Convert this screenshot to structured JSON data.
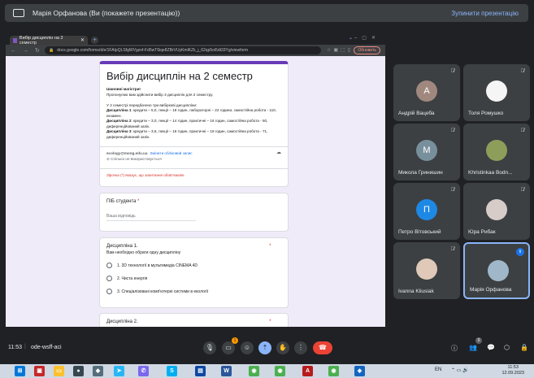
{
  "presentation_bar": {
    "title": "Марія Орфанова (Ви (покажете презентацію))",
    "stop_label": "Зупинити презентацію"
  },
  "browser": {
    "tab_title": "Вибір дисциплін на 2 семестр",
    "url": "docs.google.com/forms/d/e/1FAIpQLSfgWVgznf-Fd5wT6iqe8ZBrVUyKmlKZk_j_62qp5oi5dt33Yg/viewform",
    "update_label": "Обновить"
  },
  "form": {
    "title": "Вибір дисциплін на 2 семестр",
    "greeting": "Шановні магістри!",
    "intro": "Пропонуємо вам здійснити вибір 3 дисциплін для 2 семестру.",
    "offer": "У 2 семестрі передбачено три вибіркові дисципліни:",
    "d1_label": "Дисципліна 1",
    "d1_text": ": кредити – 5,0, лекції – 18 годин, лабораторні – 22 години, самостійна робота - 110, екзамен.",
    "d2_label": "Дисципліна 2",
    "d2_text": ": кредити – 3,0, лекції – 14 годин, практичні – 16 годин, самостійна робота - 60, диференційований залік.",
    "d3_label": "Дисципліна 3",
    "d3_text": ": кредити – 3,5, лекції – 16 годин, практичні – 18 годин, самостійна робота - 71, диференційований залік.",
    "email": "ecology@mong.edu.ua",
    "switch_account": "Змінити обліковий запис",
    "not_shared": "Спільно не використовується",
    "required_note": "Зірочка (*) вказує, що запитання обов'язкове",
    "name_label": "ПІБ студента",
    "star": "*",
    "name_placeholder": "Ваша відповідь",
    "q1_title": "Дисципліна 1.",
    "q1_subtitle": "Вам необхідно обрати одну дисципліну",
    "q1_options": [
      "1. 3D технології в мультимедіа  CINEMA 4D",
      "2. Чиста енергія",
      "3. Спеціалізовані комп'ютерні системи в екології"
    ],
    "q2_title": "Дисципліна 2."
  },
  "participants": [
    {
      "name": "Андрій Вацеба",
      "initial": "А",
      "color": "#a1887f"
    },
    {
      "name": "Толя Ромушко",
      "initial": "",
      "color": "#f5f5f5"
    },
    {
      "name": "Микола Гринишин",
      "initial": "М",
      "color": "#78909c"
    },
    {
      "name": "Khristinkaa Bodn...",
      "initial": "",
      "color": "#8d9e5a"
    },
    {
      "name": "Петро Вітовський",
      "initial": "П",
      "color": "#1e88e5"
    },
    {
      "name": "Юра Рибак",
      "initial": "",
      "color": "#d7ccc8"
    },
    {
      "name": "Ivanna Kliusiak",
      "initial": "",
      "color": "#e0c9b8"
    },
    {
      "name": "Марія Орфанова",
      "initial": "",
      "color": "#9fb7c9"
    }
  ],
  "meeting": {
    "time": "11:53",
    "code": "ode-wsff-aci",
    "reactions_badge": "1",
    "participants_count": "9"
  },
  "taskbar": {
    "lang": "EN",
    "time": "11:53",
    "date": "12.09.2023"
  }
}
